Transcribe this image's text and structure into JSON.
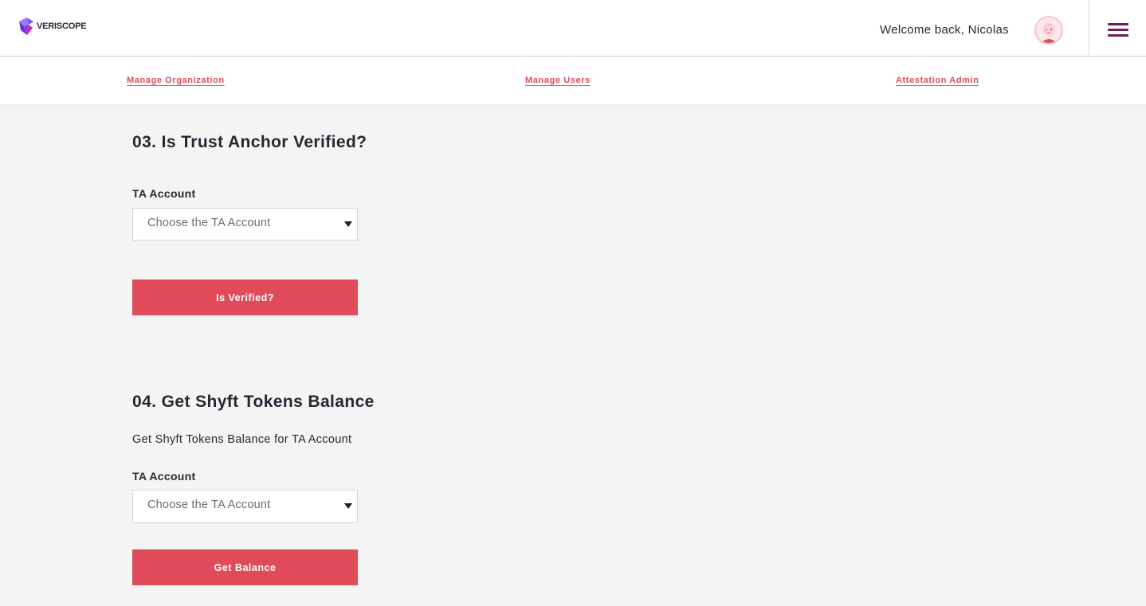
{
  "header": {
    "logo_text": "VERISCOPE",
    "welcome_text": "Welcome back, Nicolas",
    "menu_icon": "hamburger-menu-icon",
    "avatar_icon": "user-avatar-icon"
  },
  "nav": {
    "items": [
      {
        "label": "Manage Organization"
      },
      {
        "label": "Manage Users"
      },
      {
        "label": "Attestation Admin"
      }
    ]
  },
  "sections": [
    {
      "title": "03. Is Trust Anchor Verified?",
      "field_label": "TA Account",
      "select_placeholder": "Choose the TA Account",
      "button_label": "Is Verified?"
    },
    {
      "title": "04. Get Shyft Tokens Balance",
      "description": "Get Shyft Tokens Balance for TA Account",
      "field_label": "TA Account",
      "select_placeholder": "Choose the TA Account",
      "button_label": "Get Balance"
    }
  ],
  "colors": {
    "accent": "#e04b5a",
    "menu": "#6b1e56",
    "background": "#f4f4f4",
    "text": "#2b2533"
  }
}
